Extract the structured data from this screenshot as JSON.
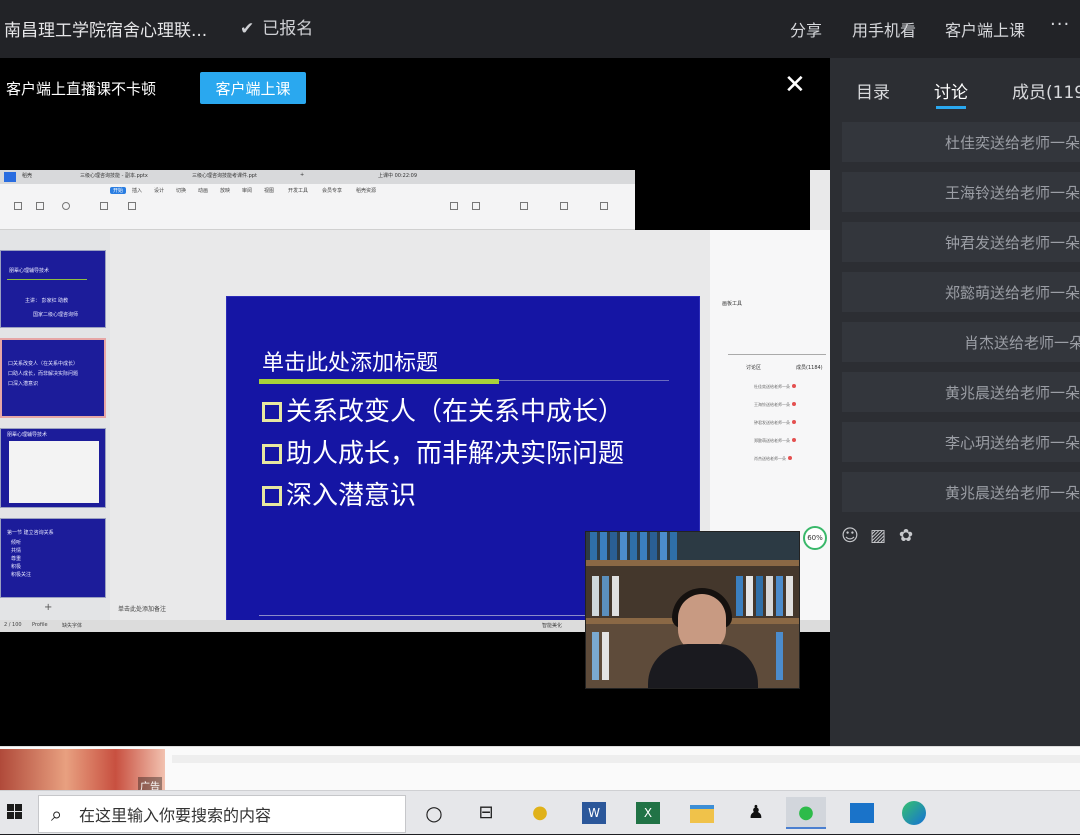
{
  "header": {
    "title": "南昌理工学院宿舍心理联...",
    "registered": "已报名",
    "actions": [
      "分享",
      "用手机看",
      "客户端上课"
    ],
    "more": "···"
  },
  "banner": {
    "text": "客户端上直播课不卡顿",
    "button": "客户端上课",
    "close": "✕"
  },
  "slide": {
    "title": "单击此处添加标题",
    "bullets": [
      "关系改变人（在关系中成长）",
      "助人成长，而非解决实际问题",
      "深入潜意识"
    ]
  },
  "ppt": {
    "tabs": [
      "稻壳",
      "三级心理咨询技能 - 副本.pptx",
      "三级心理咨询技能考课件.ppt",
      "+"
    ],
    "timer": "上课中 00:22:09",
    "menus": [
      "开始",
      "插入",
      "设计",
      "切换",
      "动画",
      "放映",
      "审阅",
      "视图",
      "开发工具",
      "会员专享",
      "稻壳资源"
    ],
    "notes": "单击此处添加备注",
    "status_left": "2 / 100",
    "status_profile": "Profile",
    "status_font": "缺失字体",
    "status_right": "智能美化",
    "thumbs": [
      {
        "title": "朋辈心理辅导技术",
        "lines": [
          "主讲：  彭家红    助教",
          "国家二级心理咨询师"
        ]
      },
      {
        "title": "",
        "lines": [
          "口关系改变人（在关系中成长）",
          "口助人成长，而非解决实际问题",
          "口深入潜意识"
        ]
      },
      {
        "title": "朋辈心理辅导技术",
        "lines": []
      },
      {
        "title": "第一节  建立咨询关系",
        "lines": [
          "倾听",
          "共情",
          "尊重",
          "积极",
          "积极关注"
        ]
      }
    ],
    "tools_panel": {
      "title": "画板工具",
      "tab": "讨论区",
      "count": "成员(1184)",
      "items": [
        "杜佳奕送给老师一朵",
        "王海铃送给老师一朵",
        "钟君发送给老师一朵",
        "郑懿萌送给老师一朵",
        "肖杰送给老师一朵"
      ],
      "percent": "60%"
    }
  },
  "sidebar": {
    "tabs": [
      "目录",
      "讨论",
      "成员(119"
    ],
    "messages": [
      "杜佳奕送给老师一朵",
      "王海铃送给老师一朵",
      "钟君发送给老师一朵",
      "郑懿萌送给老师一朵",
      "肖杰送给老师一朵",
      "黄兆晨送给老师一朵",
      "李心玥送给老师一朵",
      "黄兆晨送给老师一朵"
    ],
    "icons": [
      "emoji-icon",
      "image-icon",
      "flower-icon"
    ]
  },
  "ad": {
    "label": "广告"
  },
  "taskbar": {
    "search_placeholder": "在这里输入你要搜索的内容",
    "apps": [
      "cortana-icon",
      "task-view-icon",
      "music-app-icon",
      "word-icon",
      "excel-icon",
      "file-explorer-icon",
      "qq-icon",
      "wechat-icon",
      "photos-icon",
      "edge-icon"
    ]
  },
  "colors": {
    "accent": "#2aa8ef",
    "slide_bg": "#1515a4",
    "slide_green": "#a8d23a"
  }
}
